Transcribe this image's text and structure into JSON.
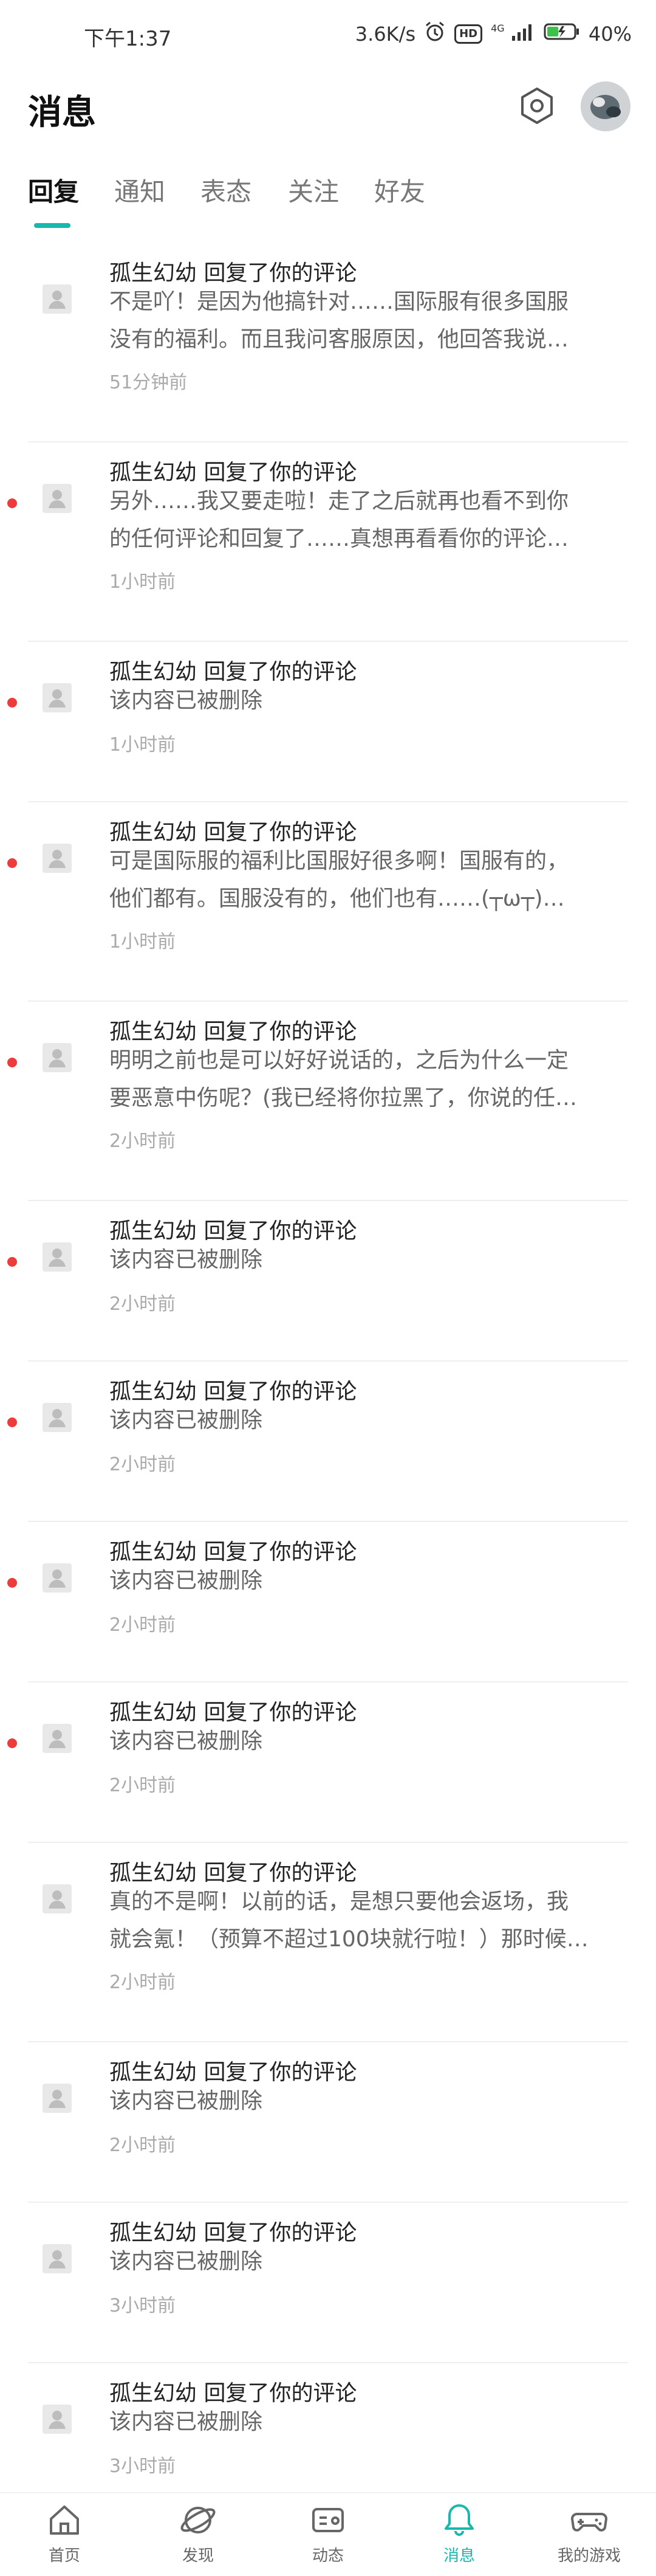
{
  "status_bar": {
    "time": "下午1:37",
    "network_speed": "3.6K/s",
    "battery": "40%",
    "signal_label": "4G",
    "hd_label": "HD"
  },
  "header": {
    "title": "消息",
    "settings_icon": "hexagon-settings-icon"
  },
  "tabs": [
    {
      "label": "回复",
      "active": true
    },
    {
      "label": "通知",
      "active": false
    },
    {
      "label": "表态",
      "active": false
    },
    {
      "label": "关注",
      "active": false
    },
    {
      "label": "好友",
      "active": false
    }
  ],
  "messages": [
    {
      "title": "孤生幻幼 回复了你的评论",
      "lines": [
        "不是吖！是因为他搞针对……国际服有很多国服",
        "没有的福利。而且我问客服原因，他回答我说…"
      ],
      "time": "51分钟前",
      "unread": false
    },
    {
      "title": "孤生幻幼 回复了你的评论",
      "lines": [
        "另外……我又要走啦！走了之后就再也看不到你",
        "的任何评论和回复了……真想再看看你的评论…"
      ],
      "time": "1小时前",
      "unread": true
    },
    {
      "title": "孤生幻幼 回复了你的评论",
      "lines": [
        "该内容已被删除"
      ],
      "time": "1小时前",
      "unread": true
    },
    {
      "title": "孤生幻幼 回复了你的评论",
      "lines": [
        "可是国际服的福利比国服好很多啊！国服有的，",
        "他们都有。国服没有的，他们也有……(┬ω┬)…"
      ],
      "time": "1小时前",
      "unread": true
    },
    {
      "title": "孤生幻幼 回复了你的评论",
      "lines": [
        "明明之前也是可以好好说话的，之后为什么一定",
        "要恶意中伤呢？(我已经将你拉黑了，你说的任…"
      ],
      "time": "2小时前",
      "unread": true
    },
    {
      "title": "孤生幻幼 回复了你的评论",
      "lines": [
        "该内容已被删除"
      ],
      "time": "2小时前",
      "unread": true
    },
    {
      "title": "孤生幻幼 回复了你的评论",
      "lines": [
        "该内容已被删除"
      ],
      "time": "2小时前",
      "unread": true
    },
    {
      "title": "孤生幻幼 回复了你的评论",
      "lines": [
        "该内容已被删除"
      ],
      "time": "2小时前",
      "unread": true
    },
    {
      "title": "孤生幻幼 回复了你的评论",
      "lines": [
        "该内容已被删除"
      ],
      "time": "2小时前",
      "unread": true
    },
    {
      "title": "孤生幻幼 回复了你的评论",
      "lines": [
        "真的不是啊！以前的话，是想只要他会返场，我",
        "就会氪！（预算不超过100块就行啦！）那时候…"
      ],
      "time": "2小时前",
      "unread": false
    },
    {
      "title": "孤生幻幼 回复了你的评论",
      "lines": [
        "该内容已被删除"
      ],
      "time": "2小时前",
      "unread": false
    },
    {
      "title": "孤生幻幼 回复了你的评论",
      "lines": [
        "该内容已被删除"
      ],
      "time": "3小时前",
      "unread": false
    },
    {
      "title": "孤生幻幼 回复了你的评论",
      "lines": [
        "该内容已被删除"
      ],
      "time": "3小时前",
      "unread": false
    }
  ],
  "bottom_nav": [
    {
      "label": "首页",
      "icon": "home-icon",
      "active": false
    },
    {
      "label": "发现",
      "icon": "discover-icon",
      "active": false
    },
    {
      "label": "动态",
      "icon": "feed-icon",
      "active": false
    },
    {
      "label": "消息",
      "icon": "bell-icon",
      "active": true
    },
    {
      "label": "我的游戏",
      "icon": "gamepad-icon",
      "active": false
    }
  ],
  "colors": {
    "accent": "#19b8ad",
    "unread_dot": "#ee3b3b"
  }
}
